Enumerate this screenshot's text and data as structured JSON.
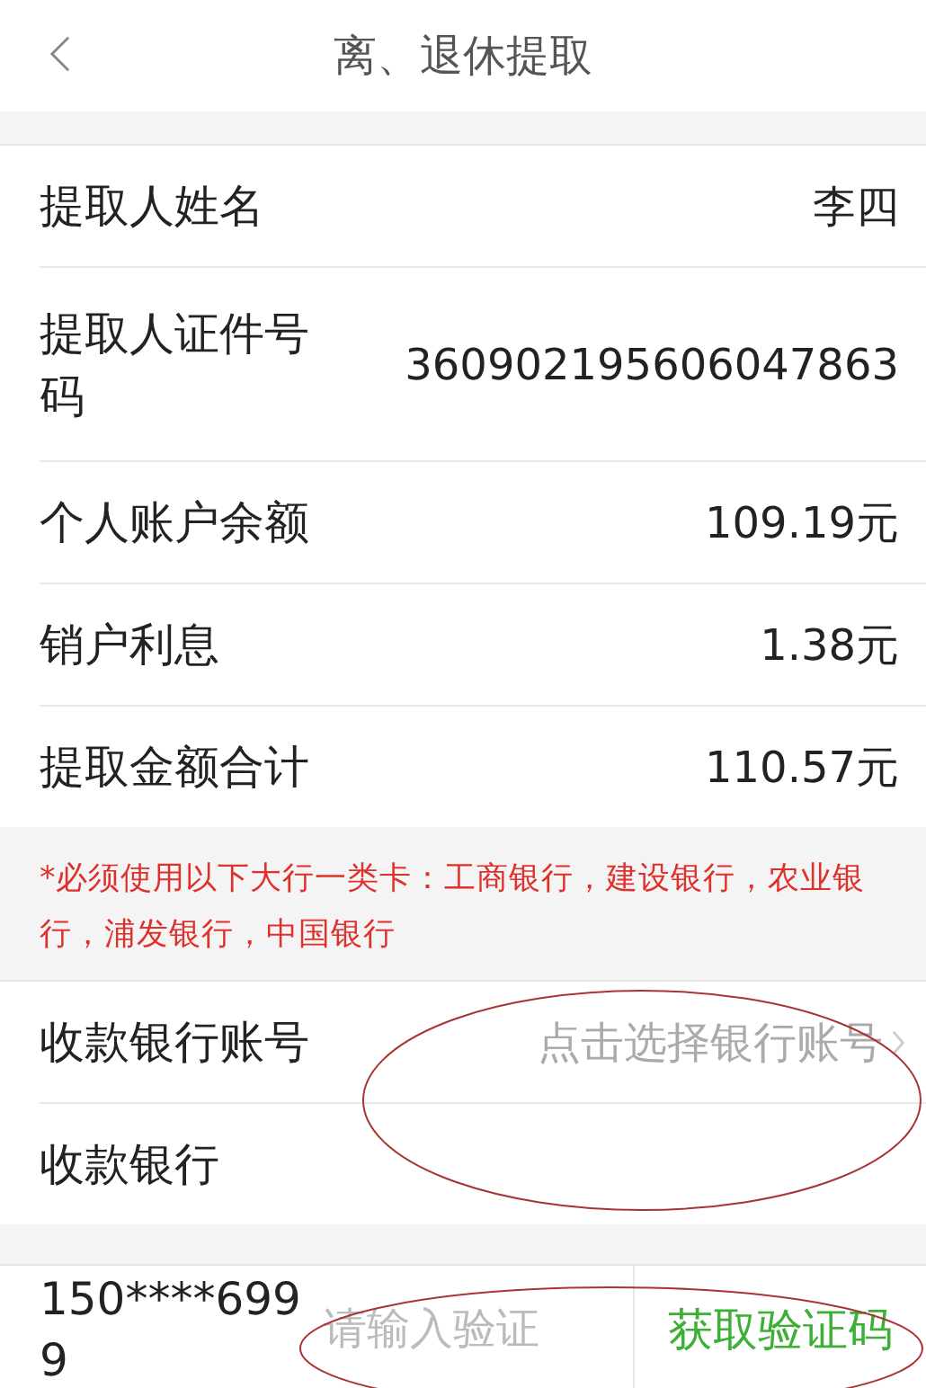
{
  "header": {
    "title": "离、退休提取"
  },
  "info_rows": [
    {
      "label": "提取人姓名",
      "value": "李四"
    },
    {
      "label": "提取人证件号码",
      "value": "360902195606047863"
    },
    {
      "label": "个人账户余额",
      "value": "109.19元"
    },
    {
      "label": "销户利息",
      "value": "1.38元"
    },
    {
      "label": "提取金额合计",
      "value": "110.57元"
    }
  ],
  "notice": "*必须使用以下大行一类卡：工商银行，建设银行，农业银行，浦发银行，中国银行",
  "bank_rows": [
    {
      "kind": "select",
      "label": "收款银行账号",
      "placeholder": "点击选择银行账号"
    },
    {
      "kind": "text",
      "label": "收款银行"
    }
  ],
  "verify": {
    "phone": "150****6999",
    "placeholder": "请输入验证",
    "button": "获取验证码"
  }
}
